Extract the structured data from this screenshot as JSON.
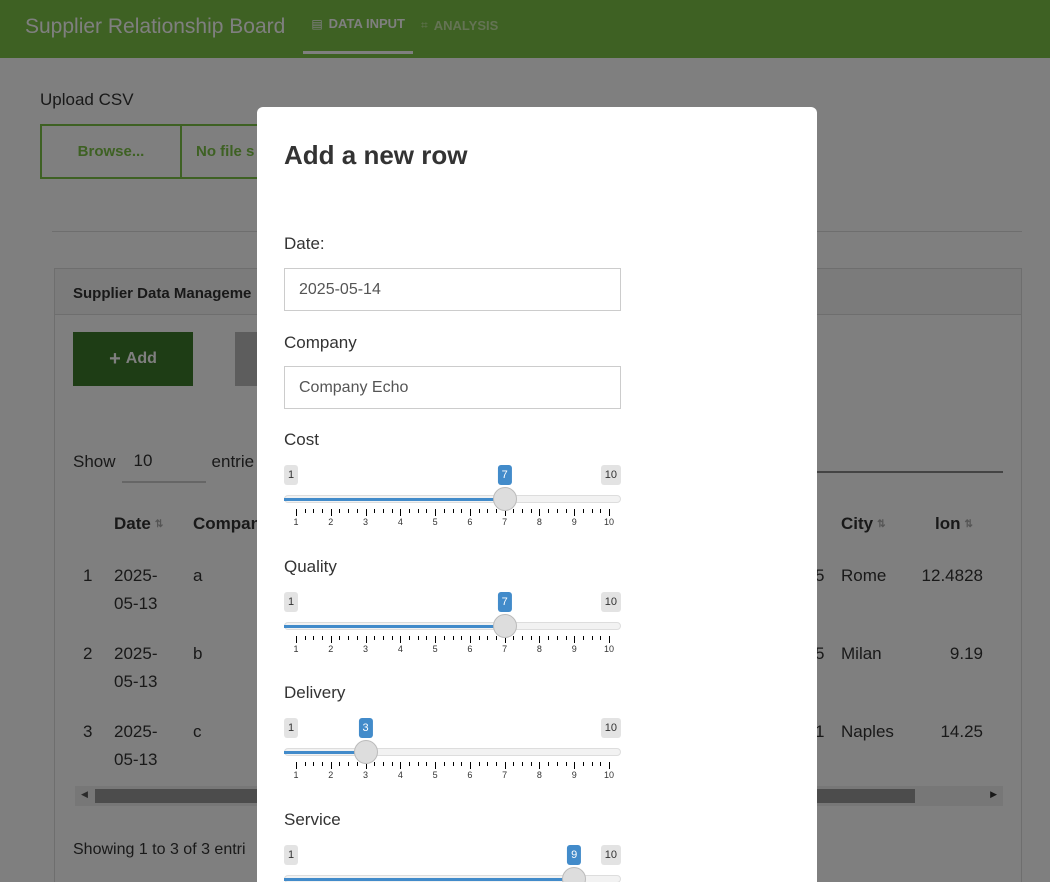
{
  "navbar": {
    "title": "Supplier Relationship Board",
    "tabs": [
      {
        "icon": "▤",
        "label": "DATA INPUT"
      },
      {
        "icon": "⌗",
        "label": "ANALYSIS"
      }
    ]
  },
  "upload": {
    "label": "Upload CSV",
    "browse_label": "Browse...",
    "file_status": "No file s"
  },
  "panel": {
    "title": "Supplier Data Manageme",
    "add_label": "Add",
    "show_label": "Show",
    "page_length": "10",
    "entries_label": "entrie",
    "columns": [
      "Date",
      "Compan",
      "City",
      "lon"
    ],
    "rows": [
      {
        "index": "1",
        "date_a": "2025-",
        "date_b": "05-13",
        "company": "a",
        "extra": "5",
        "city": "Rome",
        "lon": "12.4828"
      },
      {
        "index": "2",
        "date_a": "2025-",
        "date_b": "05-13",
        "company": "b",
        "extra": "5",
        "city": "Milan",
        "lon": "9.19"
      },
      {
        "index": "3",
        "date_a": "2025-",
        "date_b": "05-13",
        "company": "c",
        "extra": "1",
        "city": "Naples",
        "lon": "14.25"
      }
    ],
    "info": "Showing 1 to 3 of 3 entri"
  },
  "modal": {
    "title": "Add a new row",
    "date_label": "Date:",
    "date_value": "2025-05-14",
    "company_label": "Company",
    "company_value": "Company Echo",
    "sliders": [
      {
        "label": "Cost",
        "min": 1,
        "max": 10,
        "value": 7
      },
      {
        "label": "Quality",
        "min": 1,
        "max": 10,
        "value": 7
      },
      {
        "label": "Delivery",
        "min": 1,
        "max": 10,
        "value": 3
      },
      {
        "label": "Service",
        "min": 1,
        "max": 10,
        "value": 9
      }
    ]
  },
  "colors": {
    "navbar": "#7cc246",
    "add_button": "#3d7a2a",
    "slider_accent": "#428bca"
  }
}
